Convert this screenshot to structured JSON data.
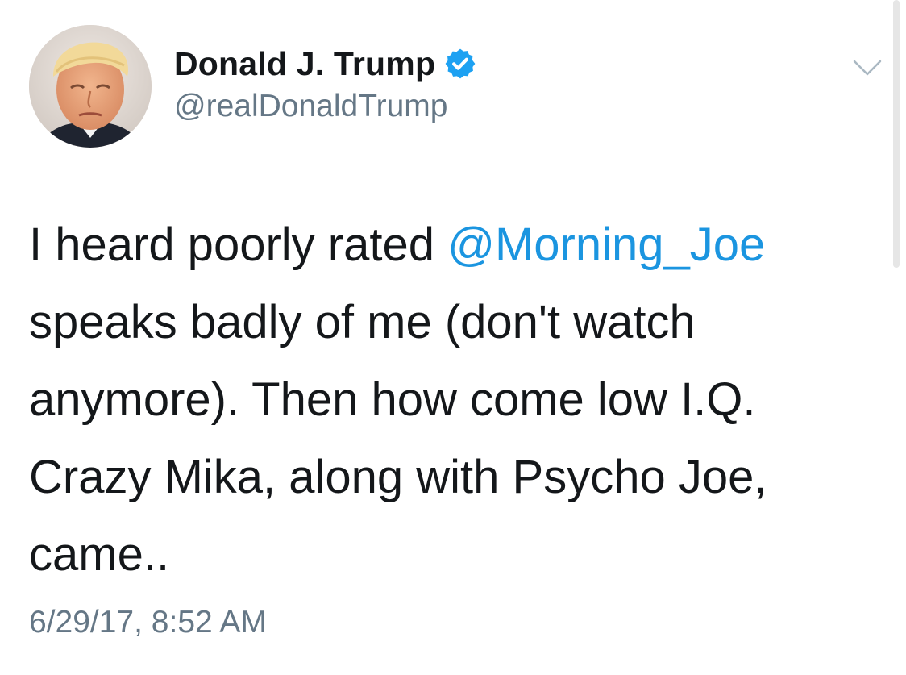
{
  "author": {
    "display_name": "Donald J. Trump",
    "handle": "@realDonaldTrump",
    "verified": true,
    "avatar_icon": "profile-photo"
  },
  "tweet": {
    "text_before_mention": "I heard poorly rated ",
    "mention": "@Morning_Joe",
    "text_after_mention": "\nspeaks badly of me (don't watch\nanymore). Then how come low I.Q.\nCrazy Mika, along with Psycho Joe,\ncame..",
    "timestamp": "6/29/17, 8:52 AM"
  },
  "icons": {
    "verified": "verified-badge-icon",
    "menu": "chevron-down-icon"
  },
  "colors": {
    "text": "#14171a",
    "secondary_text": "#657786",
    "link": "#1b95e0",
    "verified_badge": "#1da1f2"
  }
}
